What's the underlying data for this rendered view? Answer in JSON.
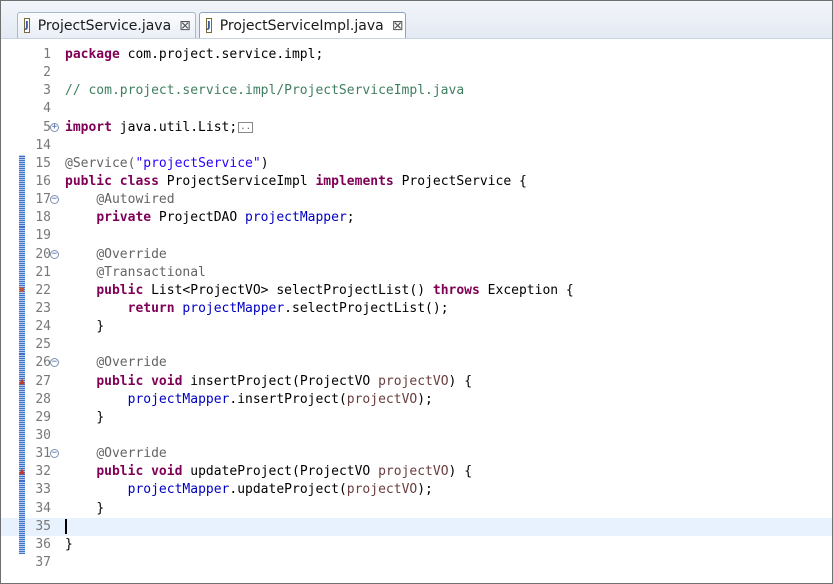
{
  "tabs": [
    {
      "label": "ProjectService.java",
      "close": "⊠",
      "icon": "J"
    },
    {
      "label": "ProjectServiceImpl.java",
      "close": "⊠",
      "icon": "J"
    }
  ],
  "editor": {
    "line_numbers": [
      "1",
      "2",
      "3",
      "4",
      "5",
      "14",
      "15",
      "16",
      "17",
      "18",
      "19",
      "20",
      "21",
      "22",
      "23",
      "24",
      "25",
      "26",
      "27",
      "28",
      "29",
      "30",
      "31",
      "32",
      "33",
      "34",
      "35",
      "36",
      "37"
    ],
    "tokens": {
      "package": "package",
      "pkg_name": " com.project.service.impl;",
      "comment_path": "// com.project.service.impl/ProjectServiceImpl.java",
      "import": "import",
      "import_name": " java.util.List;",
      "fold_dots": "..",
      "ann_service": "@Service(",
      "service_name": "\"projectService\"",
      "close_paren": ")",
      "public": "public",
      "class": "class",
      "class_name": " ProjectServiceImpl ",
      "implements": "implements",
      "iface_rest": " ProjectService {",
      "ann_autowired": "@Autowired",
      "private": "private",
      "dao_type": " ProjectDAO ",
      "field_mapper": "projectMapper",
      "semicolon": ";",
      "ann_override": "@Override",
      "ann_transactional": "@Transactional",
      "sel_sig": " List<ProjectVO> selectProjectList() ",
      "throws": "throws",
      "exc_rest": " Exception {",
      "return": "return",
      "sel_call": ".selectProjectList();",
      "close_brace": "}",
      "void": "void",
      "ins_sig": " insertProject(ProjectVO ",
      "param_vo": "projectVO",
      "sig_end": ") {",
      "ins_call": ".insertProject(",
      "call_end": ");",
      "upd_sig": " updateProject(ProjectVO ",
      "upd_call": ".updateProject("
    },
    "markers": {
      "fold_plus": "+",
      "fold_minus": "−",
      "override": "▲",
      "error": "✖"
    }
  }
}
